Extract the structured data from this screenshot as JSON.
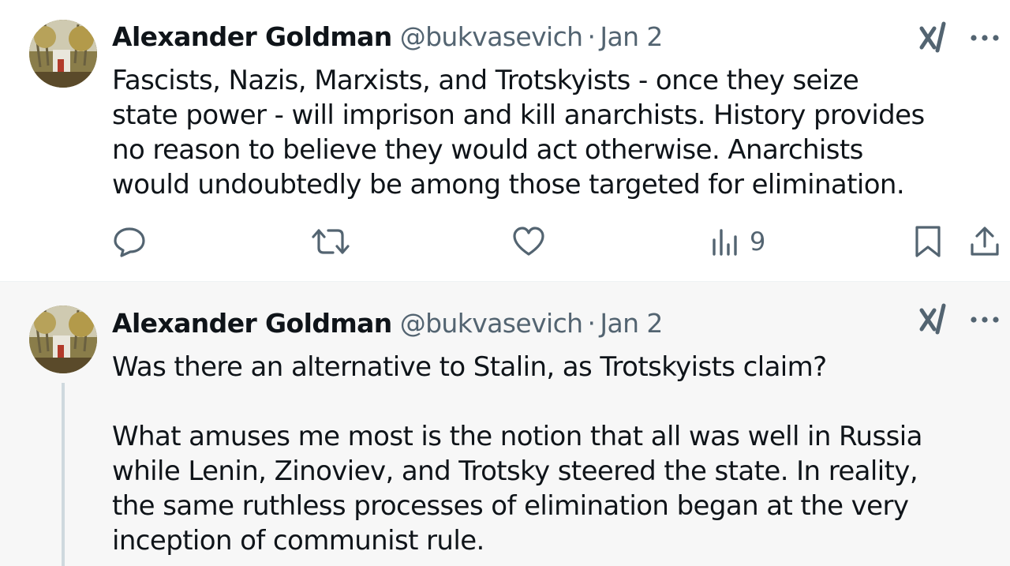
{
  "tweets": [
    {
      "author_name": "Alexander Goldman",
      "handle": "@bukvasevich",
      "separator": "·",
      "date": "Jan 2",
      "text": "Fascists, Nazis, Marxists, and Trotskyists - once they seize\nstate power - will imprison and kill anarchists. History provides\nno reason to believe they would act otherwise. Anarchists\nwould undoubtedly be among those targeted for elimination.",
      "views": "9",
      "icons": {
        "grok": "grok-icon",
        "more": "more-icon",
        "reply": "reply-icon",
        "retweet": "retweet-icon",
        "like": "like-icon",
        "views": "views-icon",
        "bookmark": "bookmark-icon",
        "share": "share-icon"
      }
    },
    {
      "author_name": "Alexander Goldman",
      "handle": "@bukvasevich",
      "separator": "·",
      "date": "Jan 2",
      "text": "Was there an alternative to Stalin, as Trotskyists claim?\n\nWhat amuses me most is the notion that all was well in Russia\nwhile Lenin, Zinoviev, and Trotsky steered the state. In reality,\nthe same ruthless processes of elimination began at the very\ninception of communist rule.",
      "icons": {
        "grok": "grok-icon",
        "more": "more-icon"
      }
    }
  ],
  "colors": {
    "text_primary": "#0f1419",
    "text_secondary": "#536471",
    "highlight_bg": "#f7f7f7",
    "thread_line": "#cfd9de"
  }
}
